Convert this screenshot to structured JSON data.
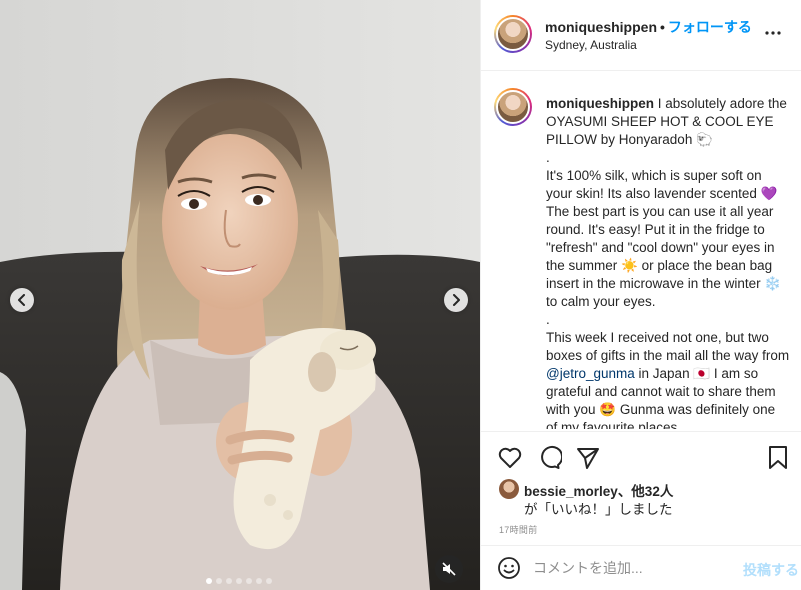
{
  "colors": {
    "accent": "#0095f6",
    "text": "#262626",
    "muted": "#8e8e8e",
    "post_disabled": "#b2dffc",
    "heart_purple": "#8c5bd6"
  },
  "media": {
    "nav_prev_icon": "chevron-left-icon",
    "nav_next_icon": "chevron-right-icon",
    "mute_icon": "speaker-muted-icon",
    "carousel_dots_count": 7,
    "carousel_active_index": 0
  },
  "header": {
    "username": "moniqueshippen",
    "separator": "•",
    "follow_label": "フォローする",
    "location": "Sydney, Australia"
  },
  "caption": {
    "username": "moniqueshippen",
    "paragraphs": [
      "I absolutely adore the OYASUMI SHEEP HOT & COOL EYE PILLOW by Honyaradoh 🐑",
      ".",
      "It's 100% silk, which is super soft on your skin! Its also lavender scented 💜 The best part is you can use it all year round. It's easy! Put it in the fridge to \"refresh\" and \"cool down\" your eyes in the summer ☀️ or place the bean bag insert in the microwave in the winter ❄️ to calm your eyes.",
      ".",
      "This week I received not one, but two boxes of gifts in the mail all the way from",
      "@jetro_gunma",
      "in Japan 🇯🇵 I am so grateful and cannot wait to share them with you 🤩 Gunma was definitely one of my favourite places"
    ]
  },
  "actions": {
    "like_icon": "heart-icon",
    "comment_icon": "comment-icon",
    "share_icon": "share-icon",
    "save_icon": "bookmark-icon"
  },
  "likes": {
    "user": "bessie_morley",
    "others_text": "、他32人",
    "suffix": "が「いいね！」しました"
  },
  "timestamp": "17時間前",
  "comment": {
    "emoji_icon": "smiley-icon",
    "placeholder": "コメントを追加...",
    "post_label": "投稿する"
  }
}
